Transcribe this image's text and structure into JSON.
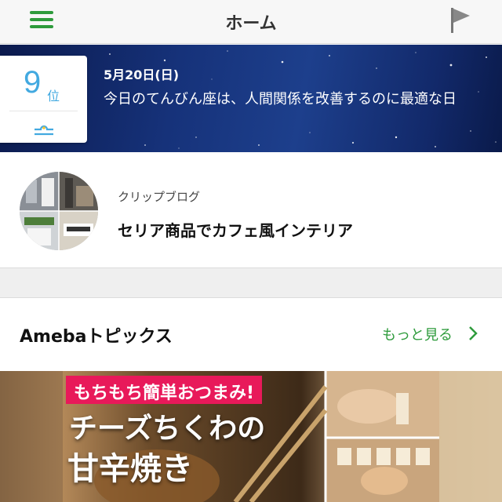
{
  "header": {
    "title": "ホーム",
    "menu_icon": "hamburger-menu-icon",
    "flag_icon": "flag-icon"
  },
  "horoscope": {
    "rank_number": "9",
    "rank_unit": "位",
    "sign_icon": "libra-icon",
    "date": "5月20日(日)",
    "message": "今日のてんびん座は、人間関係を改善するのに最適な日"
  },
  "clip_blog": {
    "category": "クリップブログ",
    "title": "セリア商品でカフェ風インテリア"
  },
  "topics": {
    "title": "Amebaトピックス",
    "more_label": "もっと見る",
    "banner": {
      "tag": "もちもち簡単おつまみ!",
      "line1": "チーズちくわの",
      "line2": "甘辛焼き"
    }
  },
  "colors": {
    "accent": "#2e9b3c",
    "rank_blue": "#42a9e0",
    "tag_pink": "#e8195a"
  }
}
